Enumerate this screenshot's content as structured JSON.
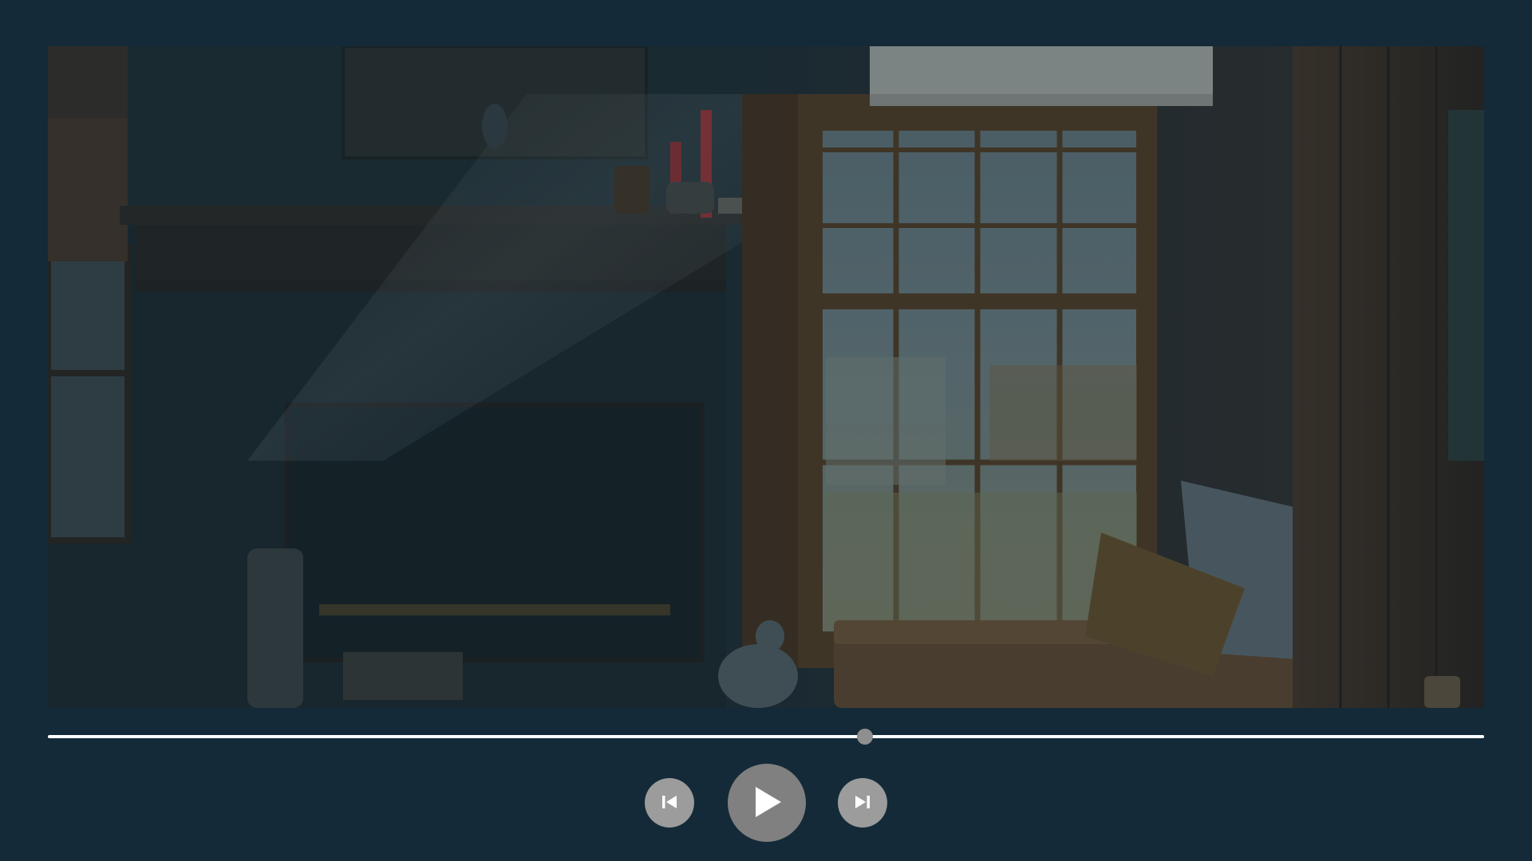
{
  "player": {
    "progress_fraction": 0.569,
    "colors": {
      "background": "#142a38",
      "track": "#ffffff",
      "handle": "#8f8f8f",
      "button_small": "#9c9c9c",
      "button_large": "#808080",
      "icon": "#ffffff"
    }
  },
  "controls": {
    "previous_icon": "skip-previous-icon",
    "play_icon": "play-icon",
    "next_icon": "skip-next-icon"
  }
}
